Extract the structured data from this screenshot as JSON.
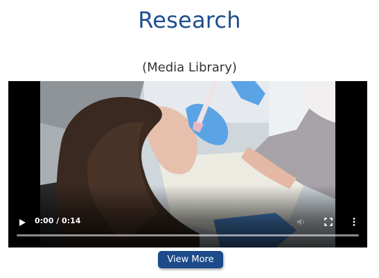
{
  "page": {
    "title": "Research",
    "subtitle": "(Media Library)"
  },
  "video": {
    "time_display": "0:00 / 0:14",
    "progress": 0,
    "controls": {
      "play_icon": "play-icon",
      "volume_icon": "volume-icon",
      "fullscreen_icon": "fullscreen-icon",
      "more_icon": "more-options-icon"
    }
  },
  "actions": {
    "view_more_label": "View More"
  },
  "colors": {
    "title": "#1d4e8f",
    "button": "#1c4a8a"
  }
}
